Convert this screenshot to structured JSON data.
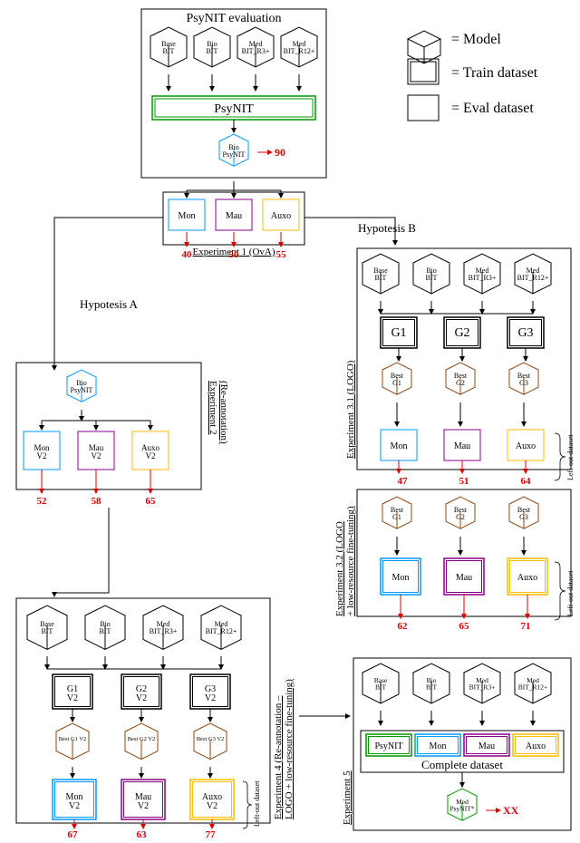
{
  "title_psynit_eval": "PsyNIT evaluation",
  "legend": {
    "model": "= Model",
    "train": "= Train dataset",
    "eval": "= Eval dataset"
  },
  "models": {
    "base": "Base\nBIT",
    "bio": "Bio\nBIT",
    "medr3": "Med\nBIT_R3+",
    "medr12": "Med\nBIT_R12+",
    "bioPsy": "Bio\nPsyNIT",
    "medPsy": "Med\nPsyNIT*"
  },
  "train": {
    "psynit": "PsyNIT",
    "g1": "G1",
    "g2": "G2",
    "g3": "G3",
    "g1v2": "G1\nV2",
    "g2v2": "G2\nV2",
    "g3v2": "G3\nV2"
  },
  "eval": {
    "mon": "Mon",
    "mau": "Mau",
    "auxo": "Auxo",
    "monv2": "Mon\nV2",
    "mauv2": "Mau\nV2",
    "auxov2": "Auxo\nV2"
  },
  "best": {
    "g1": "Best\nG1",
    "g2": "Best\nG2",
    "g3": "Best\nG3",
    "g1v2": "Best G1 V2",
    "g2v2": "Best G2 V2",
    "g3v2": "Best G3 V2"
  },
  "vals": {
    "v90": "90",
    "v40": "40",
    "v50": "50",
    "v55": "55",
    "v52": "52",
    "v58": "58",
    "v65": "65",
    "v47": "47",
    "v51": "51",
    "v64": "64",
    "v62": "62",
    "v65b": "65",
    "v71": "71",
    "v67": "67",
    "v63": "63",
    "v77": "77",
    "vxx": "XX"
  },
  "labels": {
    "exp1": "Experiment 1 (OvA)",
    "hypA": "Hypotesis A",
    "hypB": "Hypotesis B",
    "exp2a": "Experiment 2",
    "exp2b": "(Re-annotation)",
    "exp31": "Experiment 3.1 (LOGO)",
    "exp32a": "Experiment 3.2 (LOGO",
    "exp32b": "+ low-resource fine-tuning)",
    "exp4a": "Experiment 4 (Re-annotation –",
    "exp4b": "LOGO + low-resource fine-tuning)",
    "exp5": "Experiment 5",
    "leftout": "Left-out dataset",
    "complete": "Complete dataset"
  }
}
